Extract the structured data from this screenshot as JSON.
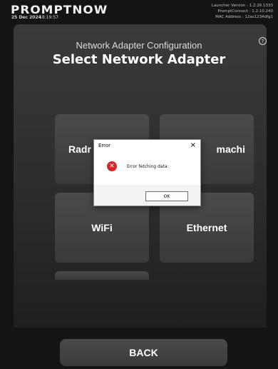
{
  "header": {
    "brand": "PROMPTNOW",
    "date": "25 Dec 2024",
    "time": "18:19:57",
    "launcher_version": "Launcher Version : 1.2.26.1333",
    "promptconnect_version": "PromptConnect : 1.2.10.240",
    "mac_address": "MAC Address : 12as1234dfg1"
  },
  "main": {
    "help_icon": "question-circle-icon",
    "subtitle": "Network Adapter Configuration",
    "title": "Select Network Adapter",
    "tiles": {
      "radmin": "Radr",
      "hamachi": "machi",
      "wifi": "WiFi",
      "ethernet": "Ethernet"
    }
  },
  "footer": {
    "back_label": "BACK"
  },
  "dialog": {
    "title": "Error",
    "close_glyph": "×",
    "message": "Error fetching data:",
    "ok_label": "OK",
    "icon": "error-x-icon",
    "icon_color": "#d8262c"
  }
}
